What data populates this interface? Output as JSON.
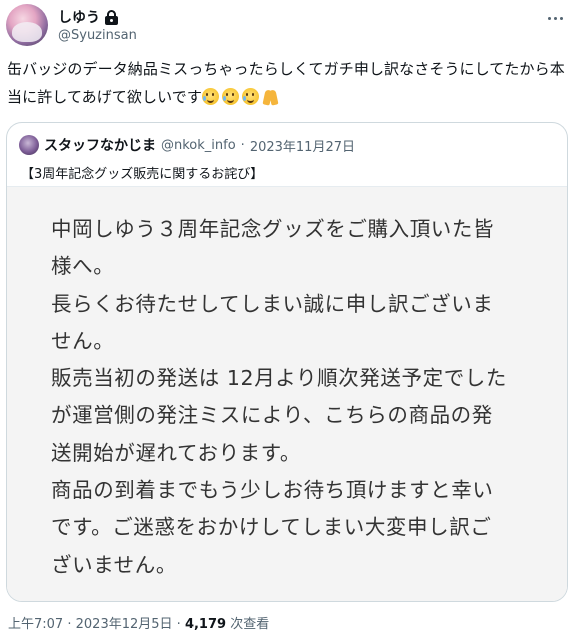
{
  "author": {
    "display_name": "しゆう",
    "handle": "@Syuzinsan",
    "lock_icon": "lock-icon",
    "avatar": "avatar"
  },
  "tweet": {
    "text": "缶バッジのデータ納品ミスっちゃったらしくてガチ申し訳なさそうにしてたから本当に許してあげて欲しいです",
    "emojis": [
      "sweat-smile-icon",
      "sweat-smile-icon",
      "sweat-smile-icon",
      "pray-icon"
    ]
  },
  "quote": {
    "display_name": "スタッフなかじま",
    "handle": "@nkok_info",
    "separator": "·",
    "date": "2023年11月27日",
    "text": "【3周年記念グッズ販売に関するお詫び】",
    "image_lines": [
      "中岡しゆう３周年記念グッズをご購入頂いた皆",
      "様へ。",
      "長らくお待たせしてしまい誠に申し訳ございま",
      "せん。",
      "販売当初の発送は 12月より順次発送予定でした",
      "が運営側の発注ミスにより、こちらの商品の発",
      "送開始が遅れております。",
      "商品の到着までもう少しお待ち頂けますと幸い",
      "です。ご迷惑をおかけしてしまい大変申し訳ご",
      "ざいません。"
    ]
  },
  "footer": {
    "time": "上午7:07",
    "separator": "·",
    "date": "2023年12月5日",
    "separator2": "·",
    "views_count": "4,179",
    "views_label": "次查看"
  },
  "colors": {
    "text": "#0f1419",
    "secondary": "#536471",
    "border": "#cfd9de"
  }
}
